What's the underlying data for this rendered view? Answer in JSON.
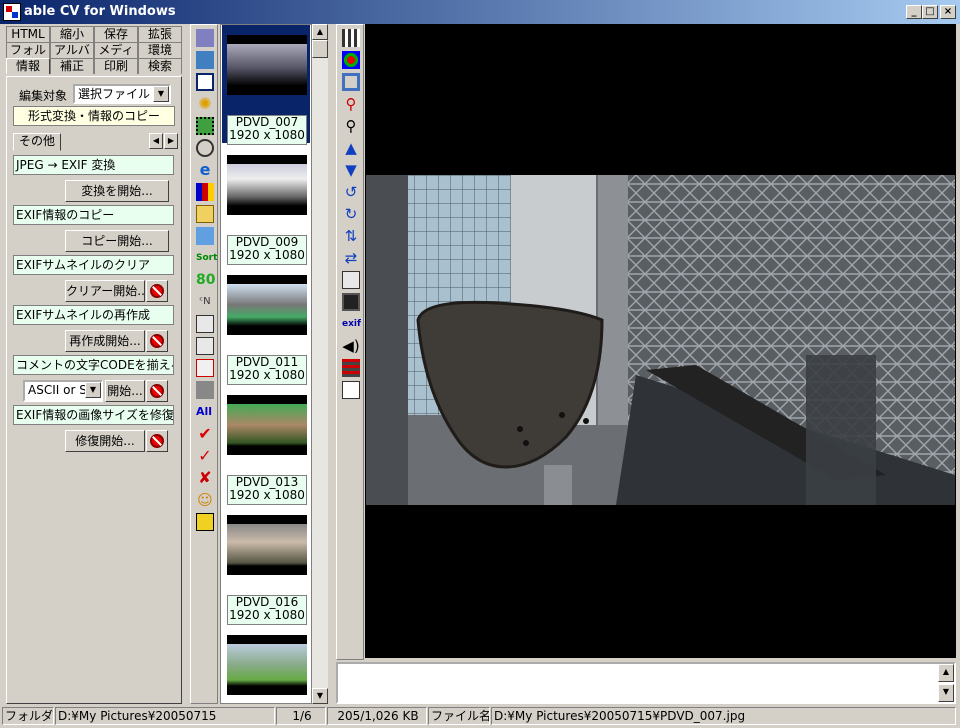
{
  "window": {
    "title": "able CV for Windows",
    "min_label": "_",
    "max_label": "□",
    "close_label": "×"
  },
  "tabs": {
    "row1": [
      "HTML",
      "縮小",
      "保存",
      "拡張"
    ],
    "row2": [
      "フォルダ",
      "アルバム",
      "メディア",
      "環境"
    ],
    "row3": [
      "情報",
      "補正",
      "印刷",
      "検索"
    ],
    "active": "情報"
  },
  "panel": {
    "edit_target_label": "編集対象",
    "edit_target_value": "選択ファイル",
    "format_banner": "形式変換・情報のコピー",
    "subtab_label": "その他",
    "items": [
      {
        "label": "JPEG → EXIF 変換",
        "button": "変換を開始..."
      },
      {
        "label": "EXIF情報のコピー",
        "button": "コピー開始..."
      },
      {
        "label": "EXIFサムネイルのクリア",
        "button": "クリアー開始..."
      },
      {
        "label": "EXIFサムネイルの再作成",
        "button": "再作成開始..."
      },
      {
        "label": "コメントの文字CODEを揃える",
        "button": "開始..."
      },
      {
        "label": "EXIF情報の画像サイズを修復",
        "button": "修復開始..."
      }
    ],
    "code_select": "ASCII or SJ"
  },
  "toolbar_icons": [
    "folder-tree-icon",
    "tools-icon",
    "window-icon",
    "sparkle-icon",
    "filmstrip-icon",
    "timer-icon",
    "browser-icon",
    "chart-icon",
    "open-folder-icon",
    "sort-list-icon",
    "sort-icon",
    "number-80-icon",
    "rename-icon",
    "copy-icon",
    "move-icon",
    "delete-icon",
    "trash-icon",
    "select-all-icon",
    "check-icon",
    "checkmark-icon",
    "uncheck-icon",
    "user-icon",
    "exit-icon"
  ],
  "toolbar2_icons": [
    "grid-icon",
    "palette-icon",
    "fit-icon",
    "zoom-red-icon",
    "magnifier-icon",
    "up-arrow-icon",
    "down-arrow-icon",
    "rotate-left-icon",
    "rotate-right-icon",
    "flip-vertical-icon",
    "flip-horizontal-icon",
    "print-icon",
    "save-icon",
    "exif-icon",
    "sound-icon",
    "film-icon",
    "document-icon"
  ],
  "thumbnails": [
    {
      "name": "PDVD_007",
      "size": "1920 x 1080",
      "selected": true
    },
    {
      "name": "PDVD_009",
      "size": "1920 x 1080",
      "selected": false
    },
    {
      "name": "PDVD_011",
      "size": "1920 x 1080",
      "selected": false
    },
    {
      "name": "PDVD_013",
      "size": "1920 x 1080",
      "selected": false
    },
    {
      "name": "PDVD_016",
      "size": "1920 x 1080",
      "selected": false
    },
    {
      "name": "",
      "size": "",
      "selected": false
    }
  ],
  "status": {
    "folder_label": "フォルダ",
    "folder_path": "D:¥My Pictures¥20050715",
    "position": "1/6",
    "filesize": "205/1,026 KB",
    "filename_label": "ファイル名",
    "filename": "D:¥My Pictures¥20050715¥PDVD_007.jpg"
  }
}
